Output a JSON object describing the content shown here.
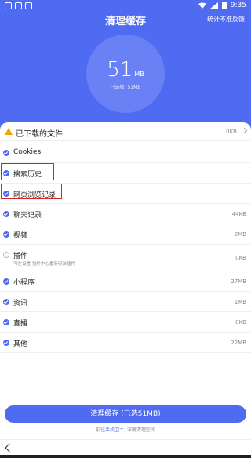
{
  "status_bar": {
    "time": "9:35"
  },
  "header": {
    "title": "清理缓存",
    "feedback": "统计不准反馈"
  },
  "summary": {
    "size_value": "51",
    "size_unit": "MB",
    "selected_note": "已选择: 51MB"
  },
  "downloaded_files": {
    "label": "已下载的文件",
    "size": "0KB"
  },
  "items": [
    {
      "label": "Cookies",
      "size": "",
      "checked": true
    },
    {
      "label": "搜索历史",
      "size": "",
      "checked": true
    },
    {
      "label": "网页浏览记录",
      "size": "",
      "checked": true
    },
    {
      "label": "聊天记录",
      "size": "44KB",
      "checked": true
    },
    {
      "label": "视频",
      "size": "2MB",
      "checked": true
    },
    {
      "label": "插件",
      "sub": "可在设置-插件中心重新安装插件",
      "size": "0KB",
      "checked": false
    },
    {
      "label": "小程序",
      "size": "27MB",
      "checked": true
    },
    {
      "label": "资讯",
      "size": "1MB",
      "checked": true
    },
    {
      "label": "直播",
      "size": "0KB",
      "checked": true
    },
    {
      "label": "其他",
      "size": "22MB",
      "checked": true
    }
  ],
  "clean_button": "清理缓存 (已选51MB)",
  "footer": {
    "prefix": "前往",
    "link": "手机卫士",
    "suffix": ", 深度清理空间"
  },
  "colors": {
    "accent": "#4f6bf2",
    "warning": "#f0a500",
    "highlight": "#e02020"
  }
}
